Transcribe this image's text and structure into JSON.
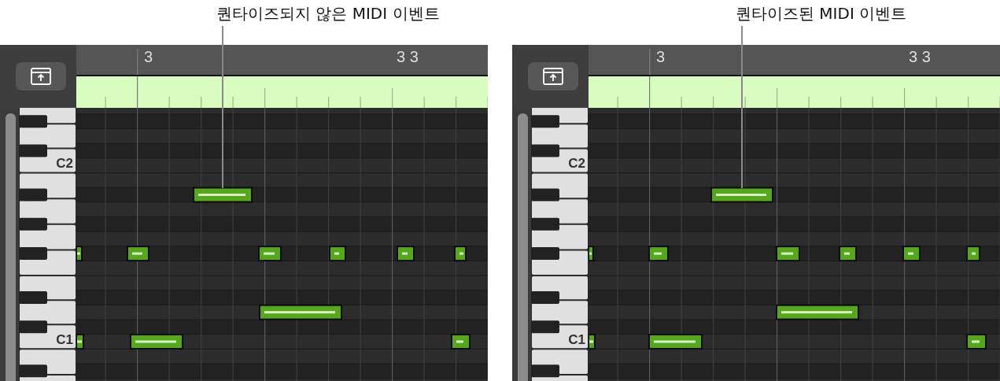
{
  "panels": [
    {
      "kind": "unquantized",
      "callout": "퀀타이즈되지 않은 MIDI 이벤트",
      "ruler_labels": [
        "3",
        "3 3"
      ],
      "key_labels": [
        "C2",
        "C1"
      ]
    },
    {
      "kind": "quantized",
      "callout": "퀀타이즈된 MIDI 이벤트",
      "ruler_labels": [
        "3",
        "3 3"
      ],
      "key_labels": [
        "C2",
        "C1"
      ]
    }
  ]
}
